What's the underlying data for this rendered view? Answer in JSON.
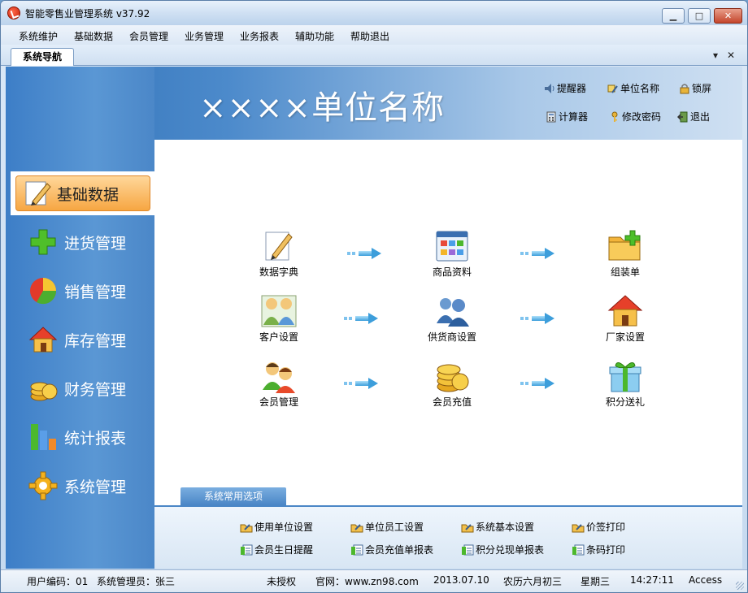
{
  "window": {
    "title": "智能零售业管理系统 v37.92"
  },
  "menu": [
    "系统维护",
    "基础数据",
    "会员管理",
    "业务管理",
    "业务报表",
    "辅助功能",
    "帮助退出"
  ],
  "tab": {
    "label": "系统导航"
  },
  "header": {
    "unit_name": "××××单位名称",
    "quick_links": {
      "reminder": "提醒器",
      "unit_name": "单位名称",
      "lock": "锁屏",
      "calculator": "计算器",
      "change_password": "修改密码",
      "exit": "退出"
    }
  },
  "sidebar": {
    "items": [
      {
        "label": "基础数据",
        "icon": "pencil-note-icon",
        "active": true
      },
      {
        "label": "进货管理",
        "icon": "green-plus-icon"
      },
      {
        "label": "销售管理",
        "icon": "pie-chart-icon"
      },
      {
        "label": "库存管理",
        "icon": "house-icon"
      },
      {
        "label": "财务管理",
        "icon": "coins-icon"
      },
      {
        "label": "统计报表",
        "icon": "bar-chart-icon"
      },
      {
        "label": "系统管理",
        "icon": "gear-icon"
      }
    ]
  },
  "workflow": {
    "nodes": [
      {
        "label": "数据字典",
        "icon": "pencil-note-icon"
      },
      {
        "label": "商品资料",
        "icon": "product-grid-icon"
      },
      {
        "label": "组装单",
        "icon": "folder-add-icon"
      },
      {
        "label": "客户设置",
        "icon": "customers-icon"
      },
      {
        "label": "供货商设置",
        "icon": "suppliers-icon"
      },
      {
        "label": "厂家设置",
        "icon": "factory-house-icon"
      },
      {
        "label": "会员管理",
        "icon": "members-icon"
      },
      {
        "label": "会员充值",
        "icon": "coins-icon"
      },
      {
        "label": "积分送礼",
        "icon": "gift-box-icon"
      }
    ]
  },
  "options": {
    "tab_label": "系统常用选项",
    "items": [
      "使用单位设置",
      "单位员工设置",
      "系统基本设置",
      "价签打印",
      "会员生日提醒",
      "会员充值单报表",
      "积分兑现单报表",
      "条码打印"
    ]
  },
  "status": {
    "user_code": "用户编码：01",
    "admin": "系统管理员：张三",
    "license": "未授权",
    "website": "官网：www.zn98.com",
    "date": "2013.07.10",
    "lunar": "农历六月初三",
    "weekday": "星期三",
    "time": "14:27:11",
    "db": "Access"
  },
  "colors": {
    "accent": "#4a86c6",
    "sidebar": "#5a97d4",
    "active_item": "#f6a642"
  }
}
